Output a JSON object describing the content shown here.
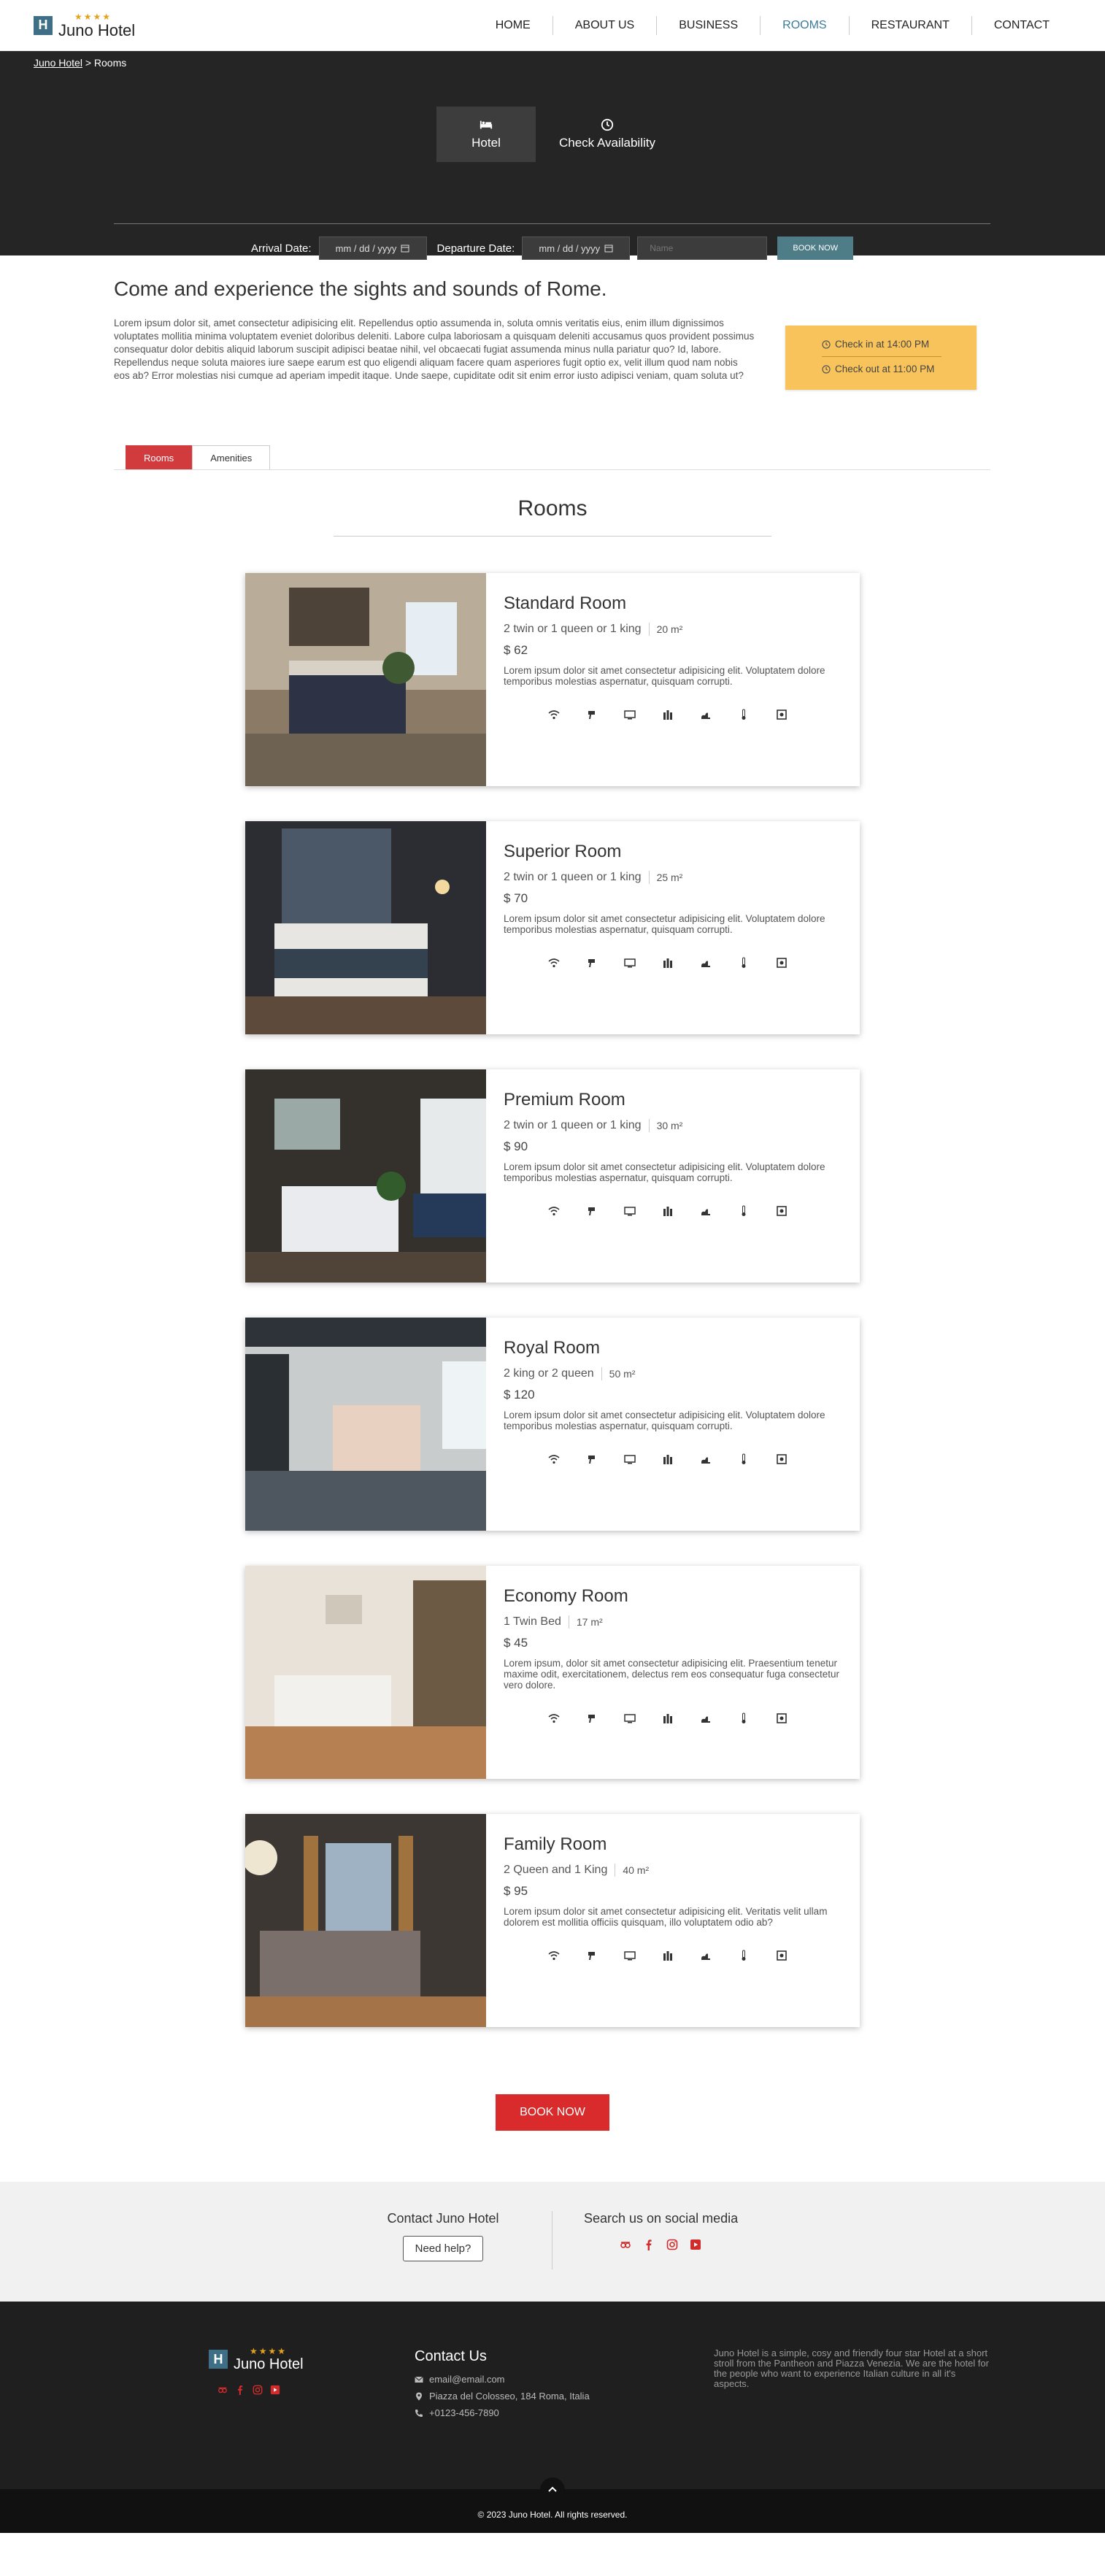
{
  "header": {
    "logo_letter": "H",
    "logo_stars": "★★★★",
    "logo_name": "Juno Hotel",
    "nav": [
      "HOME",
      "ABOUT US",
      "BUSINESS",
      "ROOMS",
      "RESTAURANT",
      "CONTACT"
    ],
    "active_nav": "ROOMS"
  },
  "breadcrumb": {
    "home": "Juno Hotel",
    "separator": " > ",
    "current": "Rooms"
  },
  "hero_tabs": {
    "hotel": "Hotel",
    "check": "Check Availability"
  },
  "booking": {
    "arrival_label": "Arrival Date:",
    "arrival_value": "mm / dd / yyyy",
    "departure_label": "Departure Date:",
    "departure_value": "mm / dd / yyyy",
    "name_placeholder": "Name",
    "book_label": "BOOK NOW"
  },
  "intro": {
    "title": "Come and experience the sights and sounds of Rome.",
    "text": "Lorem ipsum dolor sit, amet consectetur adipisicing elit. Repellendus optio assumenda in, soluta omnis veritatis eius, enim illum dignissimos voluptates mollitia minima voluptatem eveniet doloribus deleniti. Labore culpa laboriosam a quisquam deleniti accusamus quos provident possimus consequatur dolor debitis aliquid laborum suscipit adipisci beatae nihil, vel obcaecati fugiat assumenda minus nulla pariatur quo? Id, labore. Repellendus neque soluta maiores iure saepe earum est quo eligendi aliquam facere quam asperiores fugit optio ex, velit illum quod nam nobis eos ab? Error molestias nisi cumque ad aperiam impedit itaque. Unde saepe, cupiditate odit sit enim error iusto adipisci veniam, quam soluta ut?",
    "check_in": "Check in at 14:00 PM",
    "check_out": "Check out at 11:00 PM"
  },
  "section_tabs": [
    "Rooms",
    "Amenities"
  ],
  "rooms_title": "Rooms",
  "rooms": [
    {
      "name": "Standard Room",
      "beds": "2 twin or 1 queen or 1 king",
      "size": "20 m²",
      "price": "$ 62",
      "desc": "Lorem ipsum dolor sit amet consectetur adipisicing elit. Voluptatem dolore temporibus molestias aspernatur, quisquam corrupti."
    },
    {
      "name": "Superior Room",
      "beds": "2 twin or 1 queen or 1 king",
      "size": "25 m²",
      "price": "$ 70",
      "desc": "Lorem ipsum dolor sit amet consectetur adipisicing elit. Voluptatem dolore temporibus molestias aspernatur, quisquam corrupti."
    },
    {
      "name": "Premium Room",
      "beds": "2 twin or 1 queen or 1 king",
      "size": "30 m²",
      "price": "$ 90",
      "desc": "Lorem ipsum dolor sit amet consectetur adipisicing elit. Voluptatem dolore temporibus molestias aspernatur, quisquam corrupti."
    },
    {
      "name": "Royal Room",
      "beds": "2 king or 2 queen",
      "size": "50 m²",
      "price": "$ 120",
      "desc": "Lorem ipsum dolor sit amet consectetur adipisicing elit. Voluptatem dolore temporibus molestias aspernatur, quisquam corrupti."
    },
    {
      "name": "Economy Room",
      "beds": "1 Twin Bed",
      "size": "17 m²",
      "price": "$ 45",
      "desc": "Lorem ipsum, dolor sit amet consectetur adipisicing elit. Praesentium tenetur maxime odit, exercitationem, delectus rem eos consequatur fuga consectetur vero dolore."
    },
    {
      "name": "Family Room",
      "beds": "2 Queen and 1 King",
      "size": "40 m²",
      "price": "$ 95",
      "desc": "Lorem ipsum dolor sit amet consectetur adipisicing elit. Veritatis velit ullam dolorem est mollitia officiis quisquam, illo voluptatem odio ab?"
    }
  ],
  "amenity_icons": [
    "wifi-icon",
    "hairdryer-icon",
    "tv-icon",
    "minibar-icon",
    "slippers-icon",
    "thermometer-icon",
    "safe-icon"
  ],
  "book_now": "BOOK NOW",
  "contact_strip": {
    "contact_title": "Contact Juno Hotel",
    "need_help": "Need help?",
    "social_title": "Search us on social media"
  },
  "footer": {
    "logo_stars": "★★★★",
    "logo_name": "Juno Hotel",
    "contact_title": "Contact Us",
    "email": "email@email.com",
    "address": "Piazza del Colosseo, 184 Roma, Italia",
    "phone": "+0123-456-7890",
    "about": "Juno Hotel is a simple, cosy and friendly four star Hotel at a short stroll from the Pantheon and Piazza Venezia. We are the hotel for the people who want to experience Italian culture in all it's aspects.",
    "copyright": "© 2023 Juno Hotel. All rights reserved."
  },
  "colors": {
    "accent_red": "#d92b2b",
    "nav_active": "#3b7a99",
    "checkin_card": "#f7c35a",
    "hero_bg": "#262525",
    "footer_bg": "#1f1f1f"
  }
}
